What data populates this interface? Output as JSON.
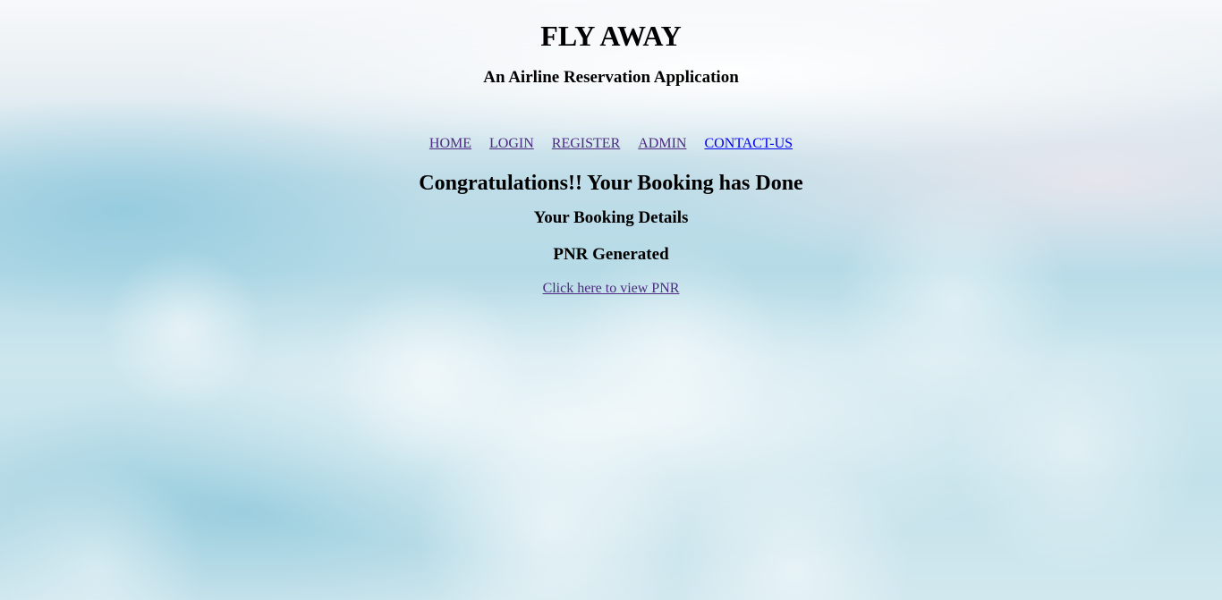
{
  "header": {
    "title": "FLY AWAY",
    "subtitle": "An Airline Reservation Application"
  },
  "nav": {
    "items": [
      {
        "label": "HOME"
      },
      {
        "label": "LOGIN"
      },
      {
        "label": "REGISTER"
      },
      {
        "label": "ADMIN"
      },
      {
        "label": "CONTACT-US"
      }
    ]
  },
  "main": {
    "congrats": "Congratulations!! Your Booking has Done",
    "details_heading": "Your Booking Details",
    "pnr_heading": "PNR Generated",
    "pnr_link": "Click here to view PNR"
  },
  "colors": {
    "visited_link": "#4b2a7f",
    "unvisited_link": "#0000ee",
    "text": "#000000"
  }
}
